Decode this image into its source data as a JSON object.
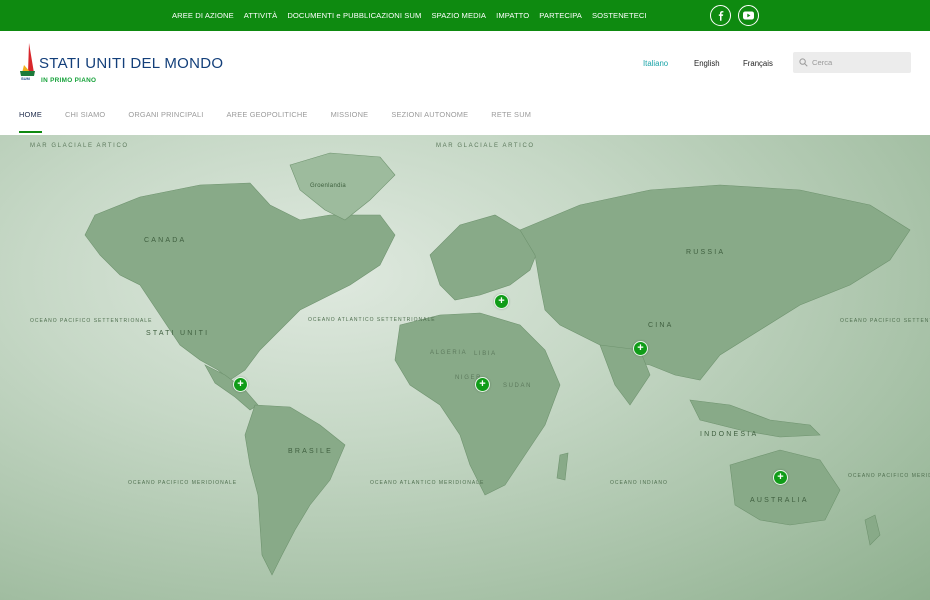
{
  "topbar": {
    "links": [
      {
        "label": "AREE DI AZIONE"
      },
      {
        "label": "ATTIVITÀ"
      },
      {
        "label": "DOCUMENTI e PUBBLICAZIONI SUM"
      },
      {
        "label": "SPAZIO MEDIA"
      },
      {
        "label": "IMPATTO"
      },
      {
        "label": "PARTECIPA"
      },
      {
        "label": "SOSTENETECI"
      }
    ],
    "social": [
      {
        "icon": "facebook-icon",
        "glyph": "f"
      },
      {
        "icon": "youtube-icon",
        "glyph": "▶"
      }
    ],
    "color": "#0e8a10"
  },
  "header": {
    "logo_text": "SUM",
    "title": "STATI UNITI DEL MONDO",
    "subtitle": "IN PRIMO PIANO",
    "languages": [
      {
        "label": "Italiano",
        "active": true
      },
      {
        "label": "English",
        "active": false
      },
      {
        "label": "Français",
        "active": false
      }
    ],
    "search": {
      "placeholder": "Cerca",
      "value": ""
    }
  },
  "nav": {
    "items": [
      {
        "label": "HOME",
        "active": true
      },
      {
        "label": "CHI SIAMO",
        "active": false
      },
      {
        "label": "ORGANI PRINCIPALI",
        "active": false
      },
      {
        "label": "AREE GEOPOLITICHE",
        "active": false
      },
      {
        "label": "MISSIONE",
        "active": false
      },
      {
        "label": "SEZIONI AUTONOME",
        "active": false
      },
      {
        "label": "RETE SUM",
        "active": false
      }
    ]
  },
  "map": {
    "labels": {
      "canada": "CANADA",
      "stati_uniti": "STATI UNITI",
      "brasile": "BRASILE",
      "russia": "RUSSIA",
      "cina": "CINA",
      "australia": "AUSTRALIA",
      "indonesia": "INDONESIA",
      "groenlandia": "Groenlandia",
      "algeria": "ALGERIA",
      "libia": "LIBIA",
      "niger": "NIGER",
      "sudan": "SUDAN",
      "mar_glaciale_1": "MAR GLACIALE ARTICO",
      "mar_glaciale_2": "MAR GLACIALE ARTICO",
      "atl_nord": "OCEANO ATLANTICO SETTENTRIONALE",
      "atl_sud": "Oceano ATLANTICO MERIDIONALE",
      "pac_nord": "OCEANO PACIFICO SETTENTRIONALE",
      "pac_sud": "Oceano PACIFICO MERIDIONALE",
      "indiano": "Oceano INDIANO",
      "pac_nord_e": "OCEANO PACIFICO SETTENTRIONALE",
      "pac_sud_e": "OCEANO PACIFICO MERIDIONALE"
    },
    "pins": [
      {
        "glyph": "+"
      },
      {
        "glyph": "+"
      },
      {
        "glyph": "+"
      },
      {
        "glyph": "+"
      },
      {
        "glyph": "+"
      }
    ],
    "pin_color": "#109c18"
  }
}
